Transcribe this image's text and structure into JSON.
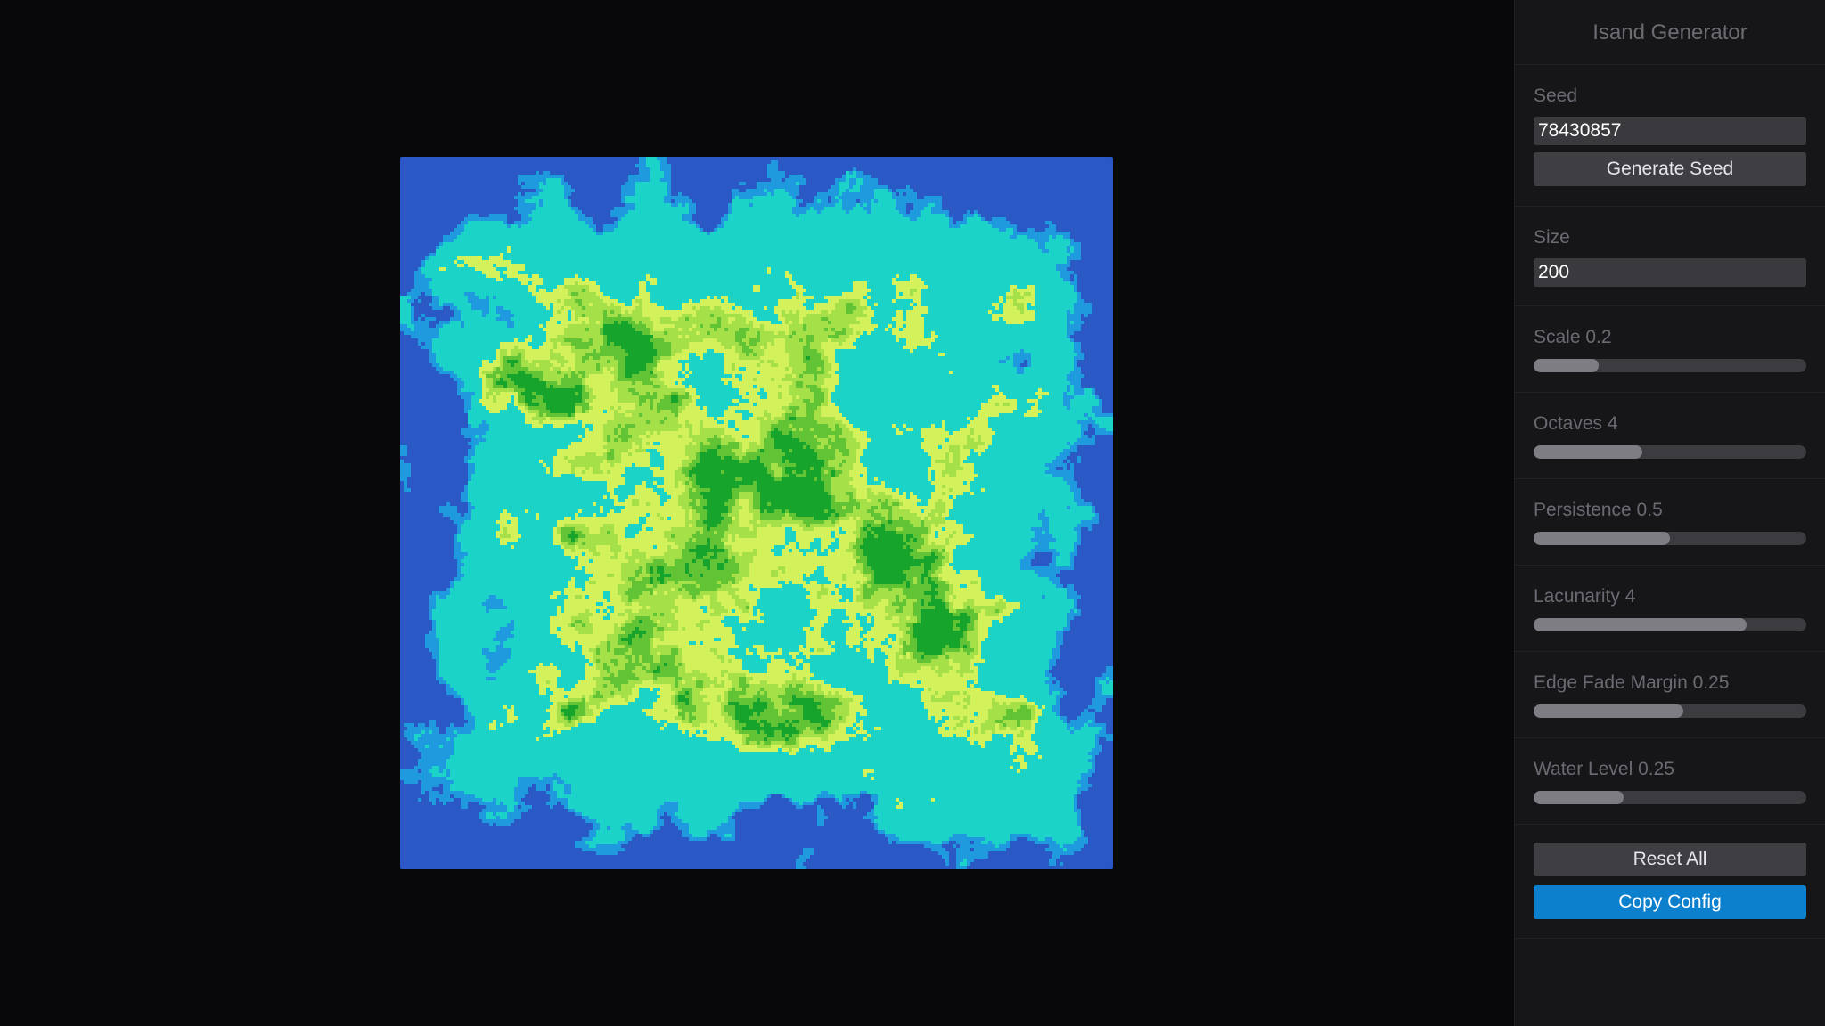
{
  "panel": {
    "title": "Isand Generator",
    "seed": {
      "label": "Seed",
      "value": "78430857",
      "button": "Generate Seed"
    },
    "size": {
      "label": "Size",
      "value": "200"
    },
    "sliders": [
      {
        "label": "Scale 0.2",
        "fraction": 0.24
      },
      {
        "label": "Octaves 4",
        "fraction": 0.4
      },
      {
        "label": "Persistence 0.5",
        "fraction": 0.5
      },
      {
        "label": "Lacunarity 4",
        "fraction": 0.78
      },
      {
        "label": "Edge Fade Margin 0.25",
        "fraction": 0.55
      },
      {
        "label": "Water Level 0.25",
        "fraction": 0.33
      }
    ],
    "reset_button": "Reset All",
    "copy_button": "Copy Config"
  },
  "colors": {
    "deep_water": "#2a59c5",
    "shallow_water": "#1f9adf",
    "coast": "#1cd3c8",
    "sand_light": "#d3f15b",
    "grass_light": "#a6e048",
    "grass": "#62c434",
    "forest": "#16a42c",
    "accent": "#0c7fcd"
  }
}
